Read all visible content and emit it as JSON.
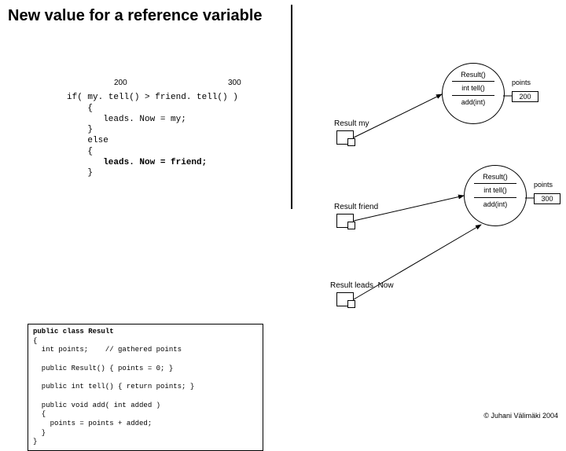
{
  "title": "New value for a reference variable",
  "labels": {
    "n200": "200",
    "n300": "300"
  },
  "code_if_lines": [
    "if( my. tell() > friend. tell() )",
    "    {",
    "       leads. Now = my;",
    "    }",
    "    else",
    "    {",
    "       leads. Now = friend;",
    "    }"
  ],
  "vars": {
    "my": "Result my",
    "friend": "Result friend",
    "leadsNow": "Result leads. Now"
  },
  "obj": {
    "ctor": "Result()",
    "tell": "int tell()",
    "add": "add(int)",
    "points": "points",
    "val200": "200",
    "val300": "300"
  },
  "class_lines": [
    "public class Result",
    "{",
    "  int points;    // gathered points",
    "",
    "  public Result() { points = 0; }",
    "",
    "  public int tell() { return points; }",
    "",
    "  public void add( int added )",
    "  {",
    "    points = points + added;",
    "  }",
    "}"
  ],
  "footer": "© Juhani Välimäki 2004"
}
